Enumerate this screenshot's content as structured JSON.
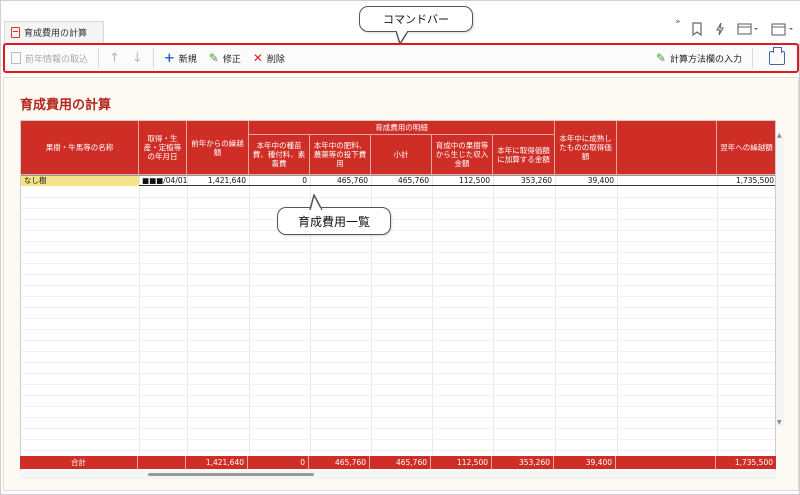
{
  "tab": {
    "title": "育成費用の計算"
  },
  "callouts": {
    "command_bar": "コマンドバー",
    "list": "育成費用一覧"
  },
  "command_bar": {
    "import_prev": "前年情報の取込",
    "add": "新規",
    "edit": "修正",
    "delete": "削除",
    "calc_method": "計算方法欄の入力"
  },
  "page": {
    "title": "育成費用の計算"
  },
  "table": {
    "group_header": "育成費用の明細",
    "headers": [
      "果樹・牛馬等の名称",
      "取得・生産・定植等の年月日",
      "前年からの繰越額",
      "本年中の種苗費、種付料、素畜費",
      "本年中の肥料、農薬等の投下費用",
      "小計",
      "育成中の果樹等から生じた収入金額",
      "本年に取得価額に加算する金額",
      "本年中に成熟したものの取得価額",
      "",
      "翌年への繰越額"
    ],
    "rows": [
      {
        "name": "なし樹",
        "date": "■■■/04/01",
        "carry_prev": "1,421,640",
        "seed": "0",
        "fertilizer": "465,760",
        "subtotal": "465,760",
        "income": "112,500",
        "add_cost": "353,260",
        "matured": "39,400",
        "blank": "",
        "carry_next": "1,735,500"
      }
    ],
    "total": {
      "label": "合計",
      "carry_prev": "1,421,640",
      "seed": "0",
      "fertilizer": "465,760",
      "subtotal": "465,760",
      "income": "112,500",
      "add_cost": "353,260",
      "matured": "39,400",
      "carry_next": "1,735,500"
    }
  },
  "colors": {
    "accent": "#cf2e27",
    "highlight": "#e0191e",
    "name_cell": "#f5e38a"
  }
}
